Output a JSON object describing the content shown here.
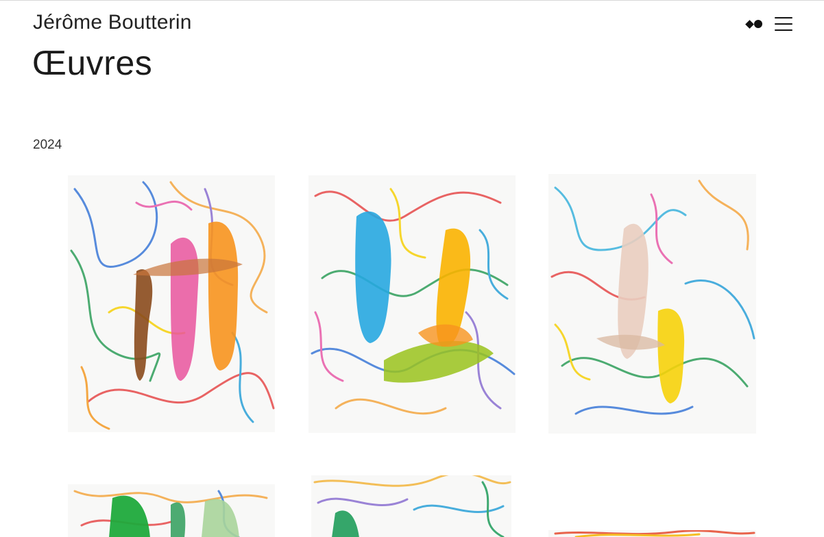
{
  "header": {
    "site_title": "Jérôme Boutterin",
    "page_title": "Œuvres"
  },
  "icons": {
    "logo_mark": "diamond-dot-icon",
    "menu": "menu-icon"
  },
  "section": {
    "year": "2024"
  },
  "artworks": [
    {
      "name": "artwork-1",
      "dominant_colors": [
        "#e9559e",
        "#f7931e",
        "#8a4a1c"
      ]
    },
    {
      "name": "artwork-2",
      "dominant_colors": [
        "#27a7e0",
        "#f9b200",
        "#9ac31c"
      ]
    },
    {
      "name": "artwork-3",
      "dominant_colors": [
        "#e9cdbf",
        "#f6d10a",
        "#3ab2dc"
      ]
    },
    {
      "name": "artwork-4",
      "dominant_colors": [
        "#1faa3c",
        "#a9d49a"
      ]
    },
    {
      "name": "artwork-5",
      "dominant_colors": [
        "#f3b43c",
        "#1f9c5a"
      ]
    },
    {
      "name": "artwork-6",
      "dominant_colors": [
        "#e64a2e",
        "#f5b400"
      ]
    }
  ],
  "colors": {
    "text": "#1b1b1b",
    "background": "#ffffff"
  }
}
